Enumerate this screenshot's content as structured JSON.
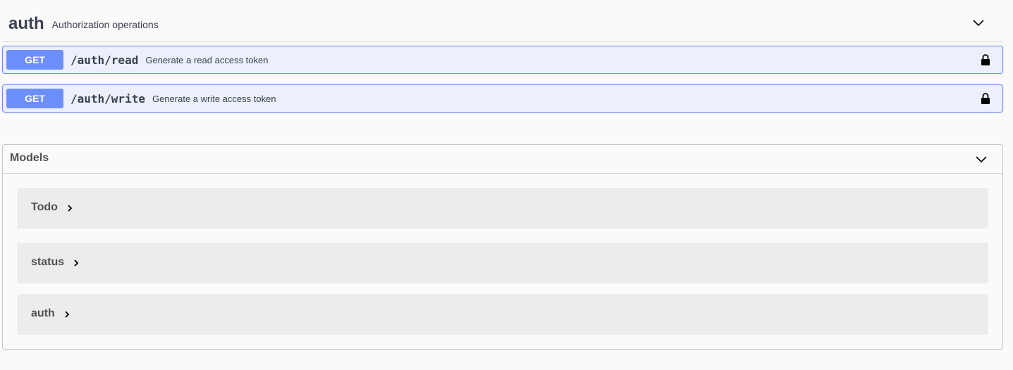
{
  "tag": {
    "name": "auth",
    "description": "Authorization operations",
    "chevron_icon": "chevron-down-icon"
  },
  "operations": [
    {
      "method": "GET",
      "path": "/auth/read",
      "summary": "Generate a read access token",
      "lock_icon": "lock-icon",
      "method_color": "#6d8ffb"
    },
    {
      "method": "GET",
      "path": "/auth/write",
      "summary": "Generate a write access token",
      "lock_icon": "lock-icon",
      "method_color": "#6d8ffb"
    }
  ],
  "models": {
    "title": "Models",
    "chevron_icon": "chevron-down-icon",
    "items": [
      {
        "name": "Todo"
      },
      {
        "name": "status"
      },
      {
        "name": "auth"
      }
    ]
  }
}
